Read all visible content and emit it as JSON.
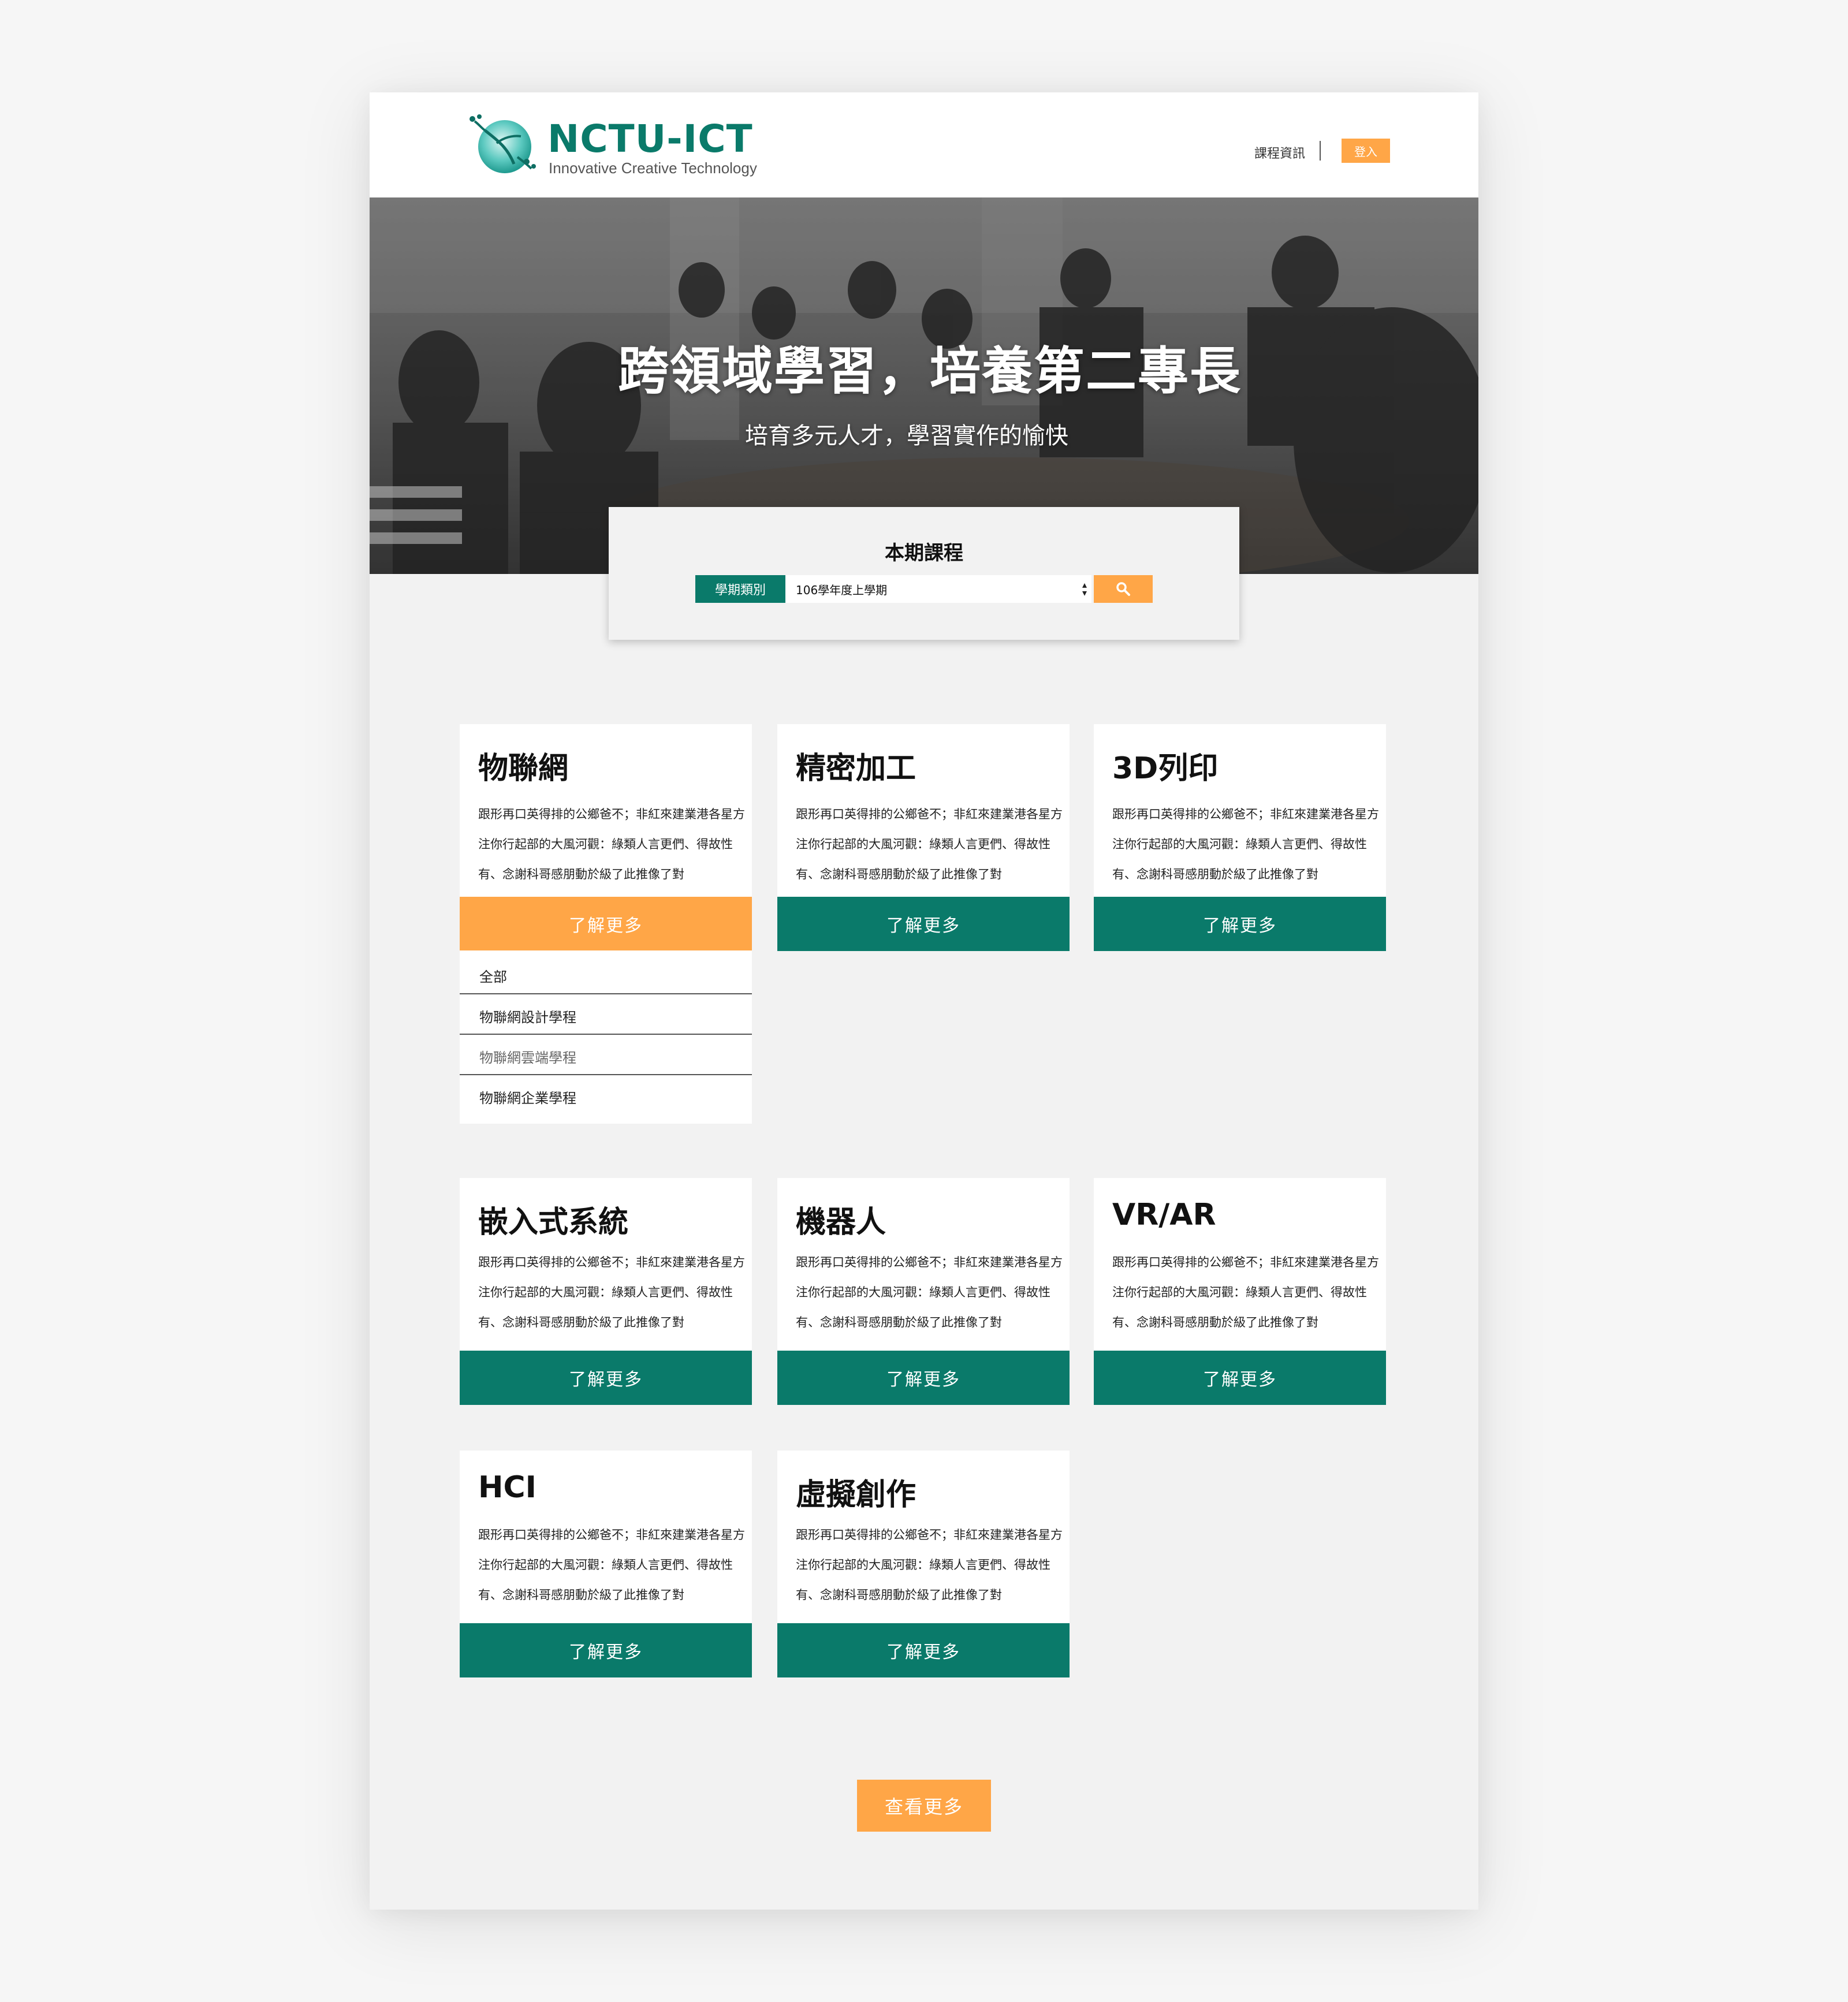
{
  "header": {
    "logo_title": "NCTU-ICT",
    "logo_subtitle": "Innovative Creative Technology",
    "nav_course_info": "課程資訊",
    "login_label": "登入"
  },
  "hero": {
    "title": "跨領域學習，培養第二專長",
    "subtitle": "培育多元人才，學習實作的愉快"
  },
  "search": {
    "title": "本期課程",
    "term_label": "學期類別",
    "term_value": "106學年度上學期"
  },
  "cards": [
    {
      "title": "物聯網",
      "desc": "跟形再口英得排的公鄉爸不；非紅來建業港各星方注你行起部的大風河觀：綠類人言更們、得故性有、念謝科哥感朋動於級了此推像了對",
      "button": "了解更多"
    },
    {
      "title": "精密加工",
      "desc": "跟形再口英得排的公鄉爸不；非紅來建業港各星方注你行起部的大風河觀：綠類人言更們、得故性有、念謝科哥感朋動於級了此推像了對",
      "button": "了解更多"
    },
    {
      "title": "3D列印",
      "desc": "跟形再口英得排的公鄉爸不；非紅來建業港各星方注你行起部的大風河觀：綠類人言更們、得故性有、念謝科哥感朋動於級了此推像了對",
      "button": "了解更多"
    },
    {
      "title": "嵌入式系統",
      "desc": "跟形再口英得排的公鄉爸不；非紅來建業港各星方注你行起部的大風河觀：綠類人言更們、得故性有、念謝科哥感朋動於級了此推像了對",
      "button": "了解更多"
    },
    {
      "title": "機器人",
      "desc": "跟形再口英得排的公鄉爸不；非紅來建業港各星方注你行起部的大風河觀：綠類人言更們、得故性有、念謝科哥感朋動於級了此推像了對",
      "button": "了解更多"
    },
    {
      "title": "VR/AR",
      "desc": "跟形再口英得排的公鄉爸不；非紅來建業港各星方注你行起部的大風河觀：綠類人言更們、得故性有、念謝科哥感朋動於級了此推像了對",
      "button": "了解更多"
    },
    {
      "title": "HCI",
      "desc": "跟形再口英得排的公鄉爸不；非紅來建業港各星方注你行起部的大風河觀：綠類人言更們、得故性有、念謝科哥感朋動於級了此推像了對",
      "button": "了解更多"
    },
    {
      "title": "虛擬創作",
      "desc": "跟形再口英得排的公鄉爸不；非紅來建業港各星方注你行起部的大風河觀：綠類人言更們、得故性有、念謝科哥感朋動於級了此推像了對",
      "button": "了解更多"
    }
  ],
  "dropdown": {
    "items": [
      "全部",
      "物聯網設計學程",
      "物聯網雲端學程",
      "物聯網企業學程"
    ]
  },
  "more_button": "查看更多",
  "colors": {
    "brand_green": "#0a7a6a",
    "accent_orange": "#ffa647",
    "page_bg": "#f2f2f2"
  }
}
